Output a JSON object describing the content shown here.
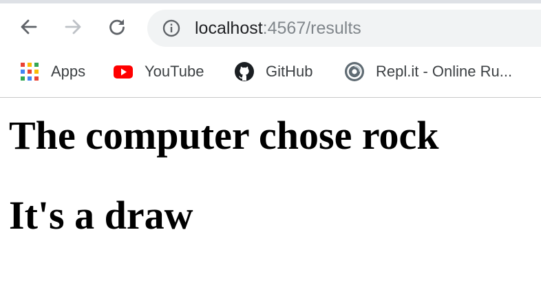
{
  "browser": {
    "icons": {
      "back": "arrow-left-icon",
      "forward": "arrow-right-icon",
      "reload": "reload-icon",
      "site_info": "info-icon"
    },
    "address_bar": {
      "host": "localhost",
      "rest": ":4567/results"
    },
    "bookmarks": [
      {
        "label": "Apps",
        "icon": "apps-grid-icon"
      },
      {
        "label": "YouTube",
        "icon": "youtube-icon"
      },
      {
        "label": "GitHub",
        "icon": "github-icon"
      },
      {
        "label": "Repl.it - Online Ru...",
        "icon": "replit-icon"
      }
    ],
    "colors": {
      "youtube_red": "#ff0000",
      "apps_red": "#ea4335",
      "apps_yellow": "#fbbc04",
      "apps_green": "#34a853",
      "apps_blue": "#4285f4"
    }
  },
  "page": {
    "heading1": "The computer chose rock",
    "heading2": "It's a draw"
  }
}
